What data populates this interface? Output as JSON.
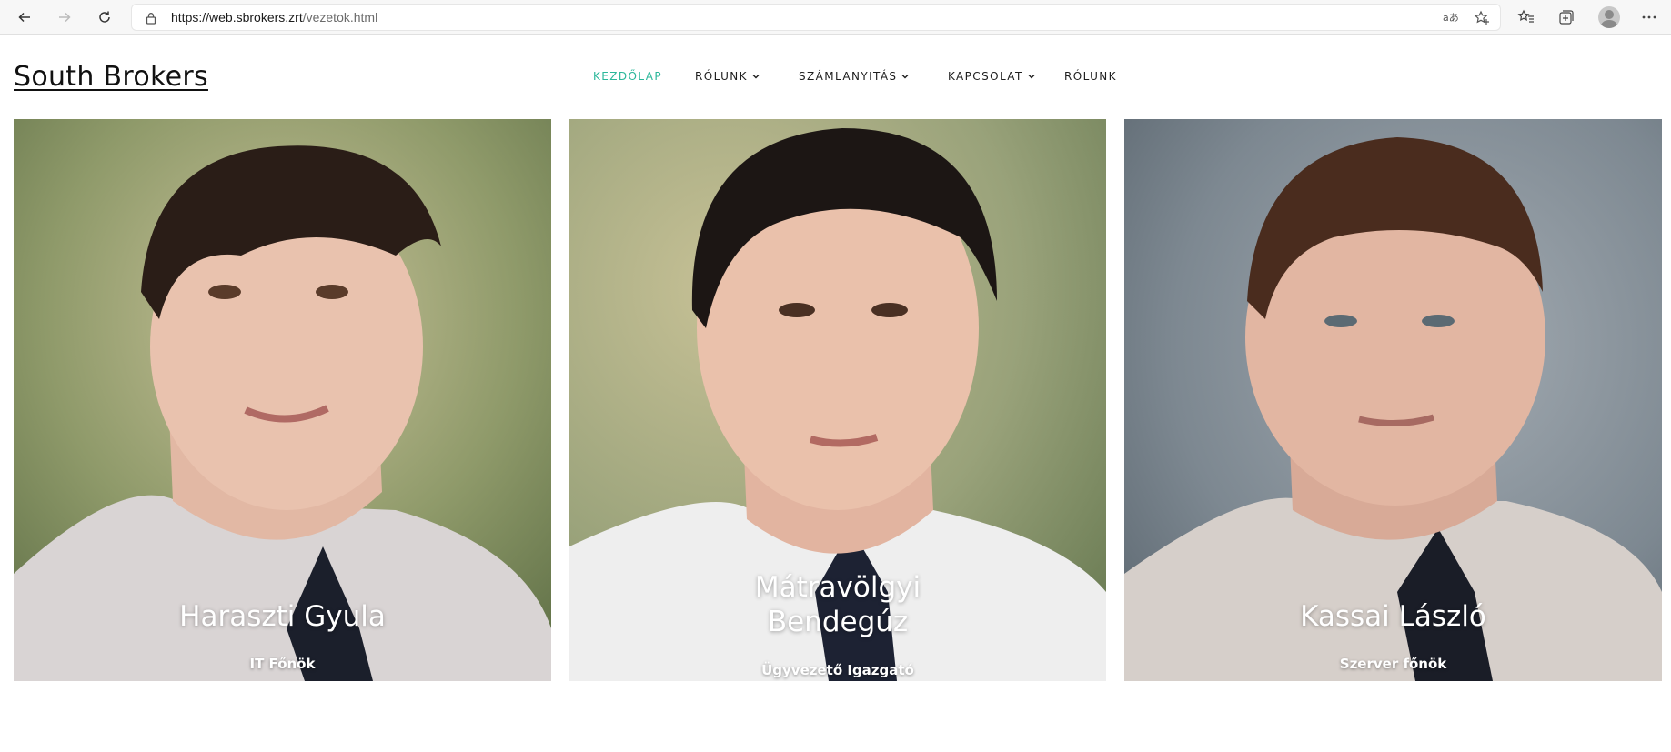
{
  "browser": {
    "url_host": "https://web.sbrokers.zrt",
    "url_path": "/vezetok.html",
    "icons": [
      "back-icon",
      "forward-icon",
      "refresh-icon",
      "lock-icon",
      "read-aloud-icon",
      "favorite-add-icon",
      "favorites-icon",
      "collections-icon",
      "profile-avatar",
      "more-icon"
    ]
  },
  "site": {
    "brand": "South Brokers",
    "accent_color": "#2bb79a",
    "nav": [
      {
        "label": "KEZDŐLAP",
        "active": true
      },
      {
        "label": "RÓLUNK",
        "dropdown": true
      },
      {
        "label": "SZÁMLANYITÁS",
        "dropdown": true
      },
      {
        "label": "KAPCSOLAT",
        "dropdown": true
      },
      {
        "label": "RÓLUNK"
      }
    ]
  },
  "team": [
    {
      "name": "Haraszti Gyula",
      "role": "IT Főnök"
    },
    {
      "name_line1": "Mátravölgyi",
      "name_line2": "Bendegúz",
      "role": "Ügyvezető Igazgató"
    },
    {
      "name": "Kassai László",
      "role": "Szerver főnök"
    }
  ]
}
